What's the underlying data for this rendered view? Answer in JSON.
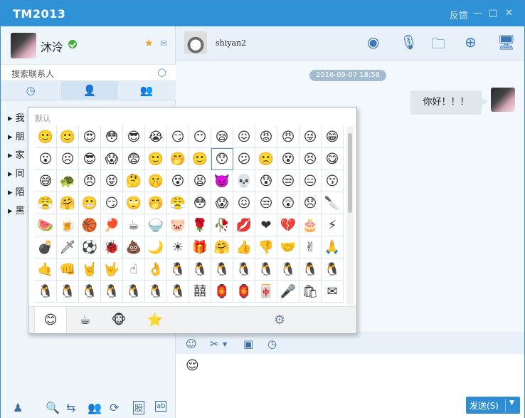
{
  "window": {
    "title": "TM2013",
    "feedback": "反馈",
    "minimize": "—",
    "maximize": "□",
    "close": "✕"
  },
  "me": {
    "name": "沐泠",
    "status": "online"
  },
  "search": {
    "placeholder": "搜索联系人"
  },
  "left_tabs": [
    {
      "icon": "clock-icon",
      "glyph": "◷"
    },
    {
      "icon": "person-icon",
      "glyph": "👤"
    },
    {
      "icon": "group-icon",
      "glyph": "👥"
    }
  ],
  "groups": [
    "我",
    "朋",
    "家",
    "同",
    "陌",
    "黑"
  ],
  "bottom_icons": [
    "♟",
    "🔍",
    "⇆",
    "👥",
    "⟳",
    "股",
    "ab"
  ],
  "peer": {
    "name": "shiyan2"
  },
  "chat_toolbar": [
    "◉",
    "🎙",
    "🗀",
    "⊕",
    "🖥"
  ],
  "messages": [
    {
      "time": "2016-09-07 18:58",
      "text": "你好！！！"
    }
  ],
  "compose_toolbar": [
    "☺",
    "✂",
    "▣",
    "◷"
  ],
  "compose_text": "😌",
  "send": {
    "label": "发送(S)",
    "dropdown": "▼"
  },
  "emoji_panel": {
    "title": "默认",
    "rows": [
      [
        "🙂",
        "🙂",
        "😍",
        "😳",
        "😎",
        "😭",
        "😏",
        "😶",
        "😪",
        "😖",
        "😡",
        "😠",
        "😜",
        "😁"
      ],
      [
        "😮",
        "☹",
        "😎",
        "😱",
        "😨",
        "🙂",
        "🤭",
        "🙂",
        "😯",
        "😕",
        "🙁",
        "😵",
        "😣",
        "😋"
      ],
      [
        "😅",
        "🐢",
        "😠",
        "😝",
        "🤔",
        "🤫",
        "😵",
        "😫",
        "👿",
        "💀",
        "😰",
        "😒",
        "😑",
        "😗"
      ],
      [
        "😤",
        "🤗",
        "😬",
        "😏",
        "🙄",
        "🤭",
        "😤",
        "😳",
        "😱",
        "😖",
        "😒",
        "😲",
        "😞",
        "🔪"
      ],
      [
        "🍉",
        "🍺",
        "🏀",
        "🏓",
        "☕",
        "🍚",
        "🐷",
        "🌹",
        "🥀",
        "💋",
        "❤",
        "💔",
        "🎂",
        "⚡"
      ],
      [
        "💣",
        "🗡",
        "⚽",
        "🐞",
        "💩",
        "🌙",
        "☀",
        "🎁",
        "🤗",
        "👍",
        "👎",
        "🤝",
        "✌",
        "🙏"
      ],
      [
        "🤙",
        "👊",
        "🤘",
        "🤟",
        "☝",
        "👌",
        "🐧",
        "🐧",
        "🐧",
        "🐧",
        "🐧",
        "🐧",
        "🐧",
        "🐧"
      ],
      [
        "🐧",
        "🐧",
        "🐧",
        "🐧",
        "🐧",
        "🐧",
        "🐧",
        "囍",
        "🏮",
        "🏮",
        "🀄",
        "🎤",
        "🛍",
        "✉"
      ]
    ],
    "tabs": [
      "😊",
      "☕",
      "🐵",
      "⭐"
    ],
    "settings": "⚙"
  }
}
